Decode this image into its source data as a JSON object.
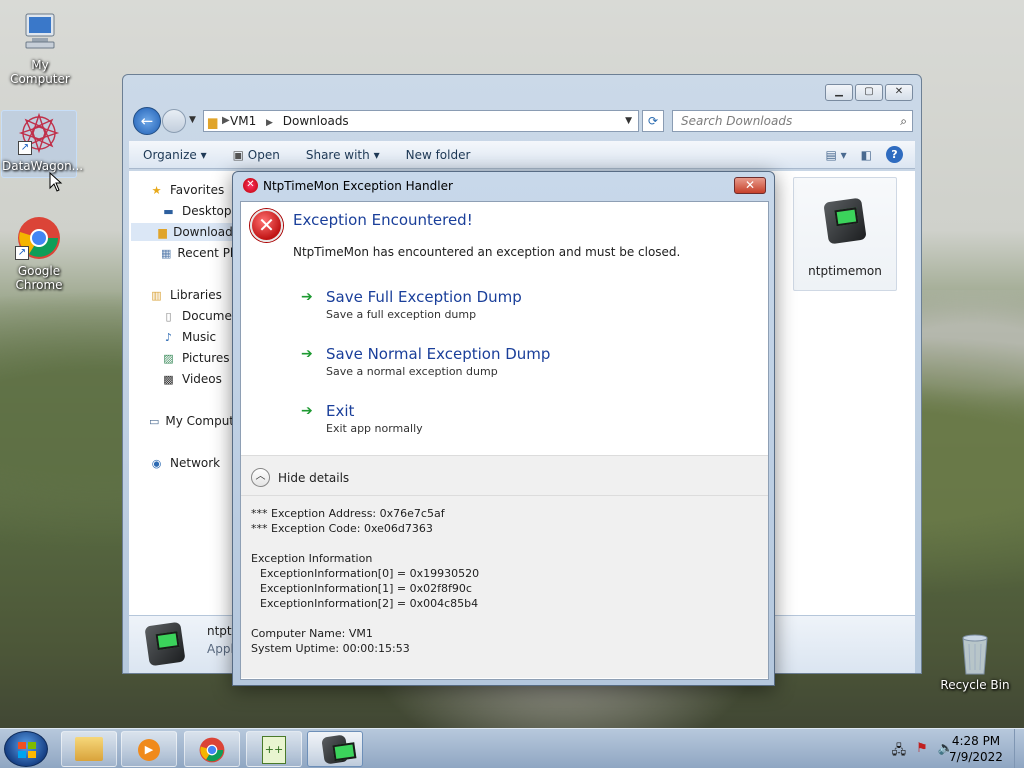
{
  "desktop": {
    "icons": [
      {
        "label": "My Computer"
      },
      {
        "label": "DataWagon..."
      },
      {
        "label": "Google Chrome"
      },
      {
        "label": "Recycle Bin"
      }
    ]
  },
  "explorer": {
    "breadcrumb": [
      "VM1",
      "Downloads"
    ],
    "search_placeholder": "Search Downloads",
    "toolbar": {
      "organize": "Organize",
      "open": "Open",
      "share_with": "Share with",
      "new_folder": "New folder"
    },
    "nav": {
      "favorites": "Favorites",
      "desktop": "Desktop",
      "downloads": "Downloads",
      "recent_places": "Recent Places",
      "libraries": "Libraries",
      "documents": "Documents",
      "music": "Music",
      "pictures": "Pictures",
      "videos": "Videos",
      "my_computer": "My Computer",
      "network": "Network"
    },
    "file": {
      "name": "ntptimemon"
    },
    "details": {
      "name": "ntptimemon",
      "type": "Application"
    }
  },
  "dialog": {
    "title": "NtpTimeMon Exception Handler",
    "heading": "Exception Encountered!",
    "message": "NtpTimeMon has encountered an exception and must be closed.",
    "commands": [
      {
        "title": "Save Full Exception Dump",
        "subtitle": "Save a full exception dump"
      },
      {
        "title": "Save Normal Exception Dump",
        "subtitle": "Save a normal exception dump"
      },
      {
        "title": "Exit",
        "subtitle": "Exit app normally"
      }
    ],
    "hide_details": "Hide details",
    "info_lines": {
      "address": "*** Exception Address: 0x76e7c5af",
      "code": "*** Exception Code: 0xe06d7363",
      "info_header": "Exception Information",
      "info0": "ExceptionInformation[0] = 0x19930520",
      "info1": "ExceptionInformation[1] = 0x02f8f90c",
      "info2": "ExceptionInformation[2] = 0x004c85b4",
      "computer": "Computer Name: VM1",
      "uptime": "System Uptime: 00:00:15:53"
    }
  },
  "taskbar": {
    "time": "4:28 PM",
    "date": "7/9/2022"
  },
  "colors": {
    "heading_blue": "#1a3f9a",
    "arrow_green": "#1e9a32",
    "error_red": "#c01414"
  }
}
